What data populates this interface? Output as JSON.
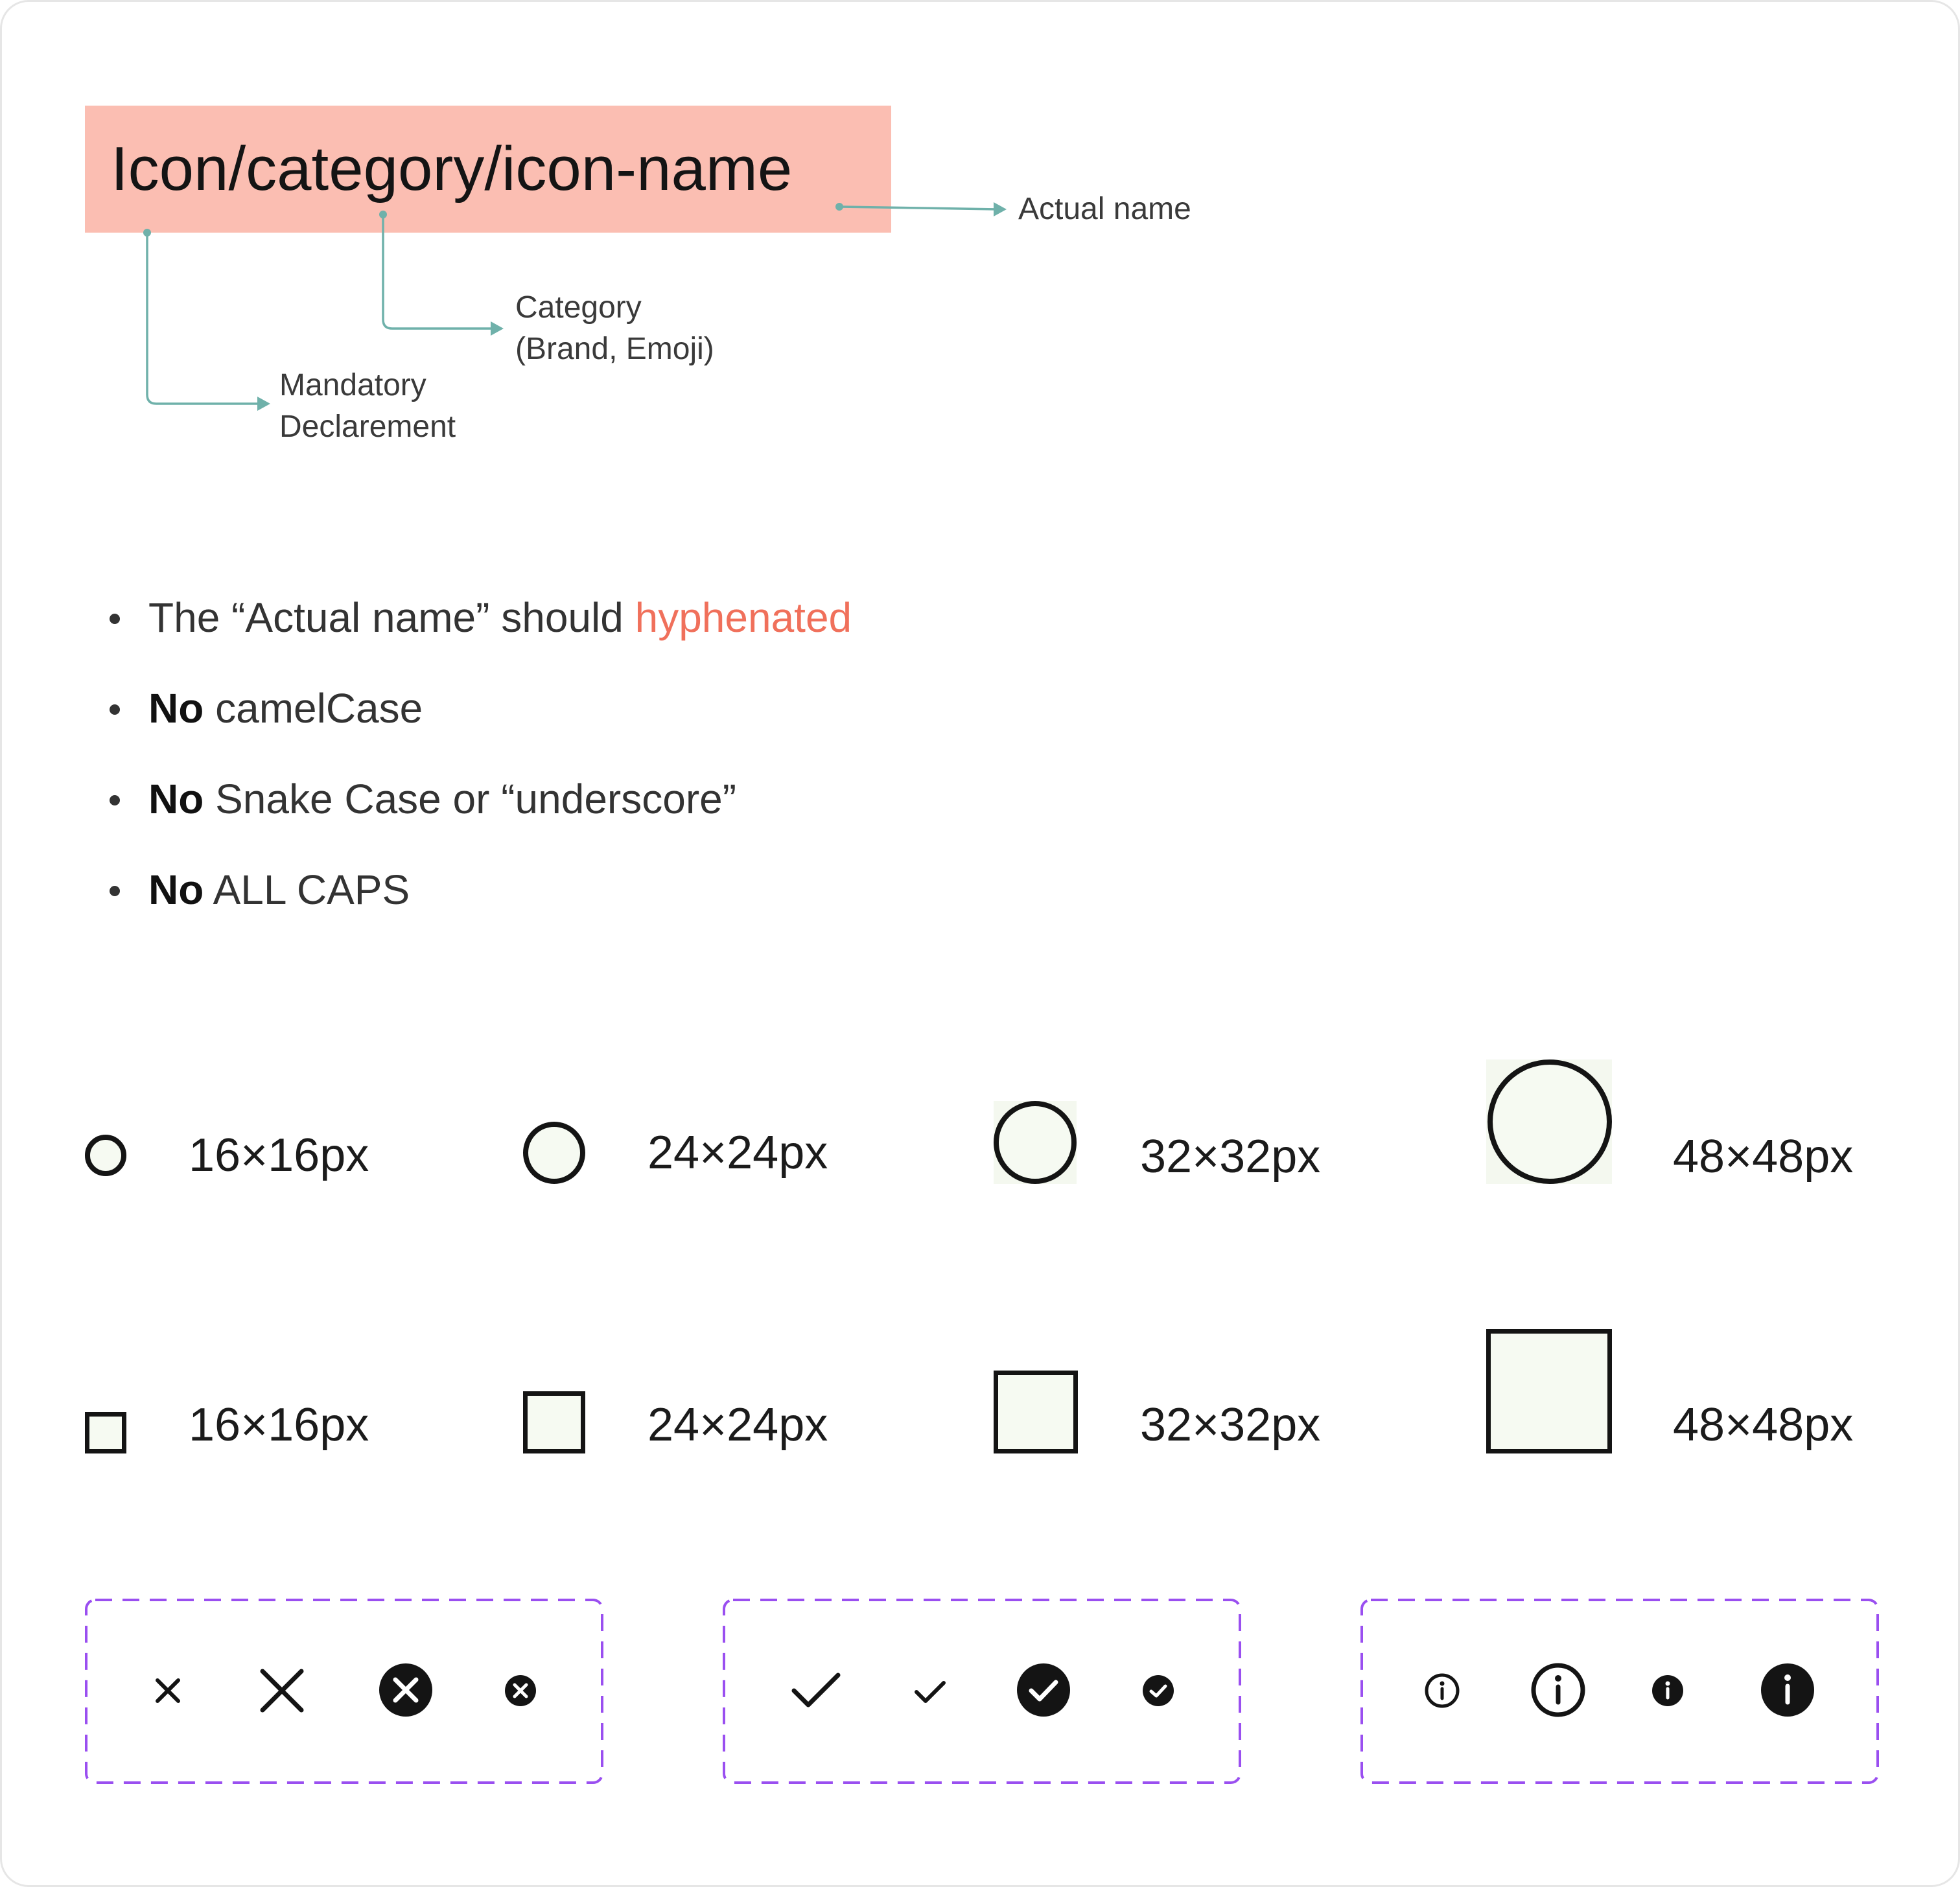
{
  "naming": {
    "pattern": "Icon/category/icon-name",
    "annotations": {
      "actual_name": "Actual name",
      "category_line1": "Category",
      "category_line2": "(Brand, Emoji)",
      "mandatory_line1": "Mandatory",
      "mandatory_line2": "Declarement"
    }
  },
  "rules": [
    {
      "prefix": "",
      "text": "The “Actual name” should ",
      "highlight": "hyphenated"
    },
    {
      "prefix": "No",
      "text": " camelCase",
      "highlight": ""
    },
    {
      "prefix": "No",
      "text": " Snake Case or “underscore”",
      "highlight": ""
    },
    {
      "prefix": "No",
      "text": " ALL CAPS",
      "highlight": ""
    }
  ],
  "sizes": {
    "circle_row": [
      "16×16px",
      "24×24px",
      "32×32px",
      "48×48px"
    ],
    "square_row": [
      "16×16px",
      "24×24px",
      "32×32px",
      "48×48px"
    ]
  },
  "icon_groups": [
    {
      "name": "close",
      "icons": [
        "close-small-icon",
        "close-large-icon",
        "close-circle-filled-large-icon",
        "close-circle-filled-small-icon"
      ]
    },
    {
      "name": "check",
      "icons": [
        "check-large-icon",
        "check-small-icon",
        "check-circle-filled-large-icon",
        "check-circle-filled-small-icon"
      ]
    },
    {
      "name": "info",
      "icons": [
        "info-outline-small-icon",
        "info-outline-large-icon",
        "info-filled-small-icon",
        "info-filled-large-icon"
      ]
    }
  ],
  "colors": {
    "name_box": "#fbbeb2",
    "connector": "#6fb1aa",
    "highlight": "#f0705b",
    "group_border": "#9a4ff0",
    "icon": "#141414"
  }
}
